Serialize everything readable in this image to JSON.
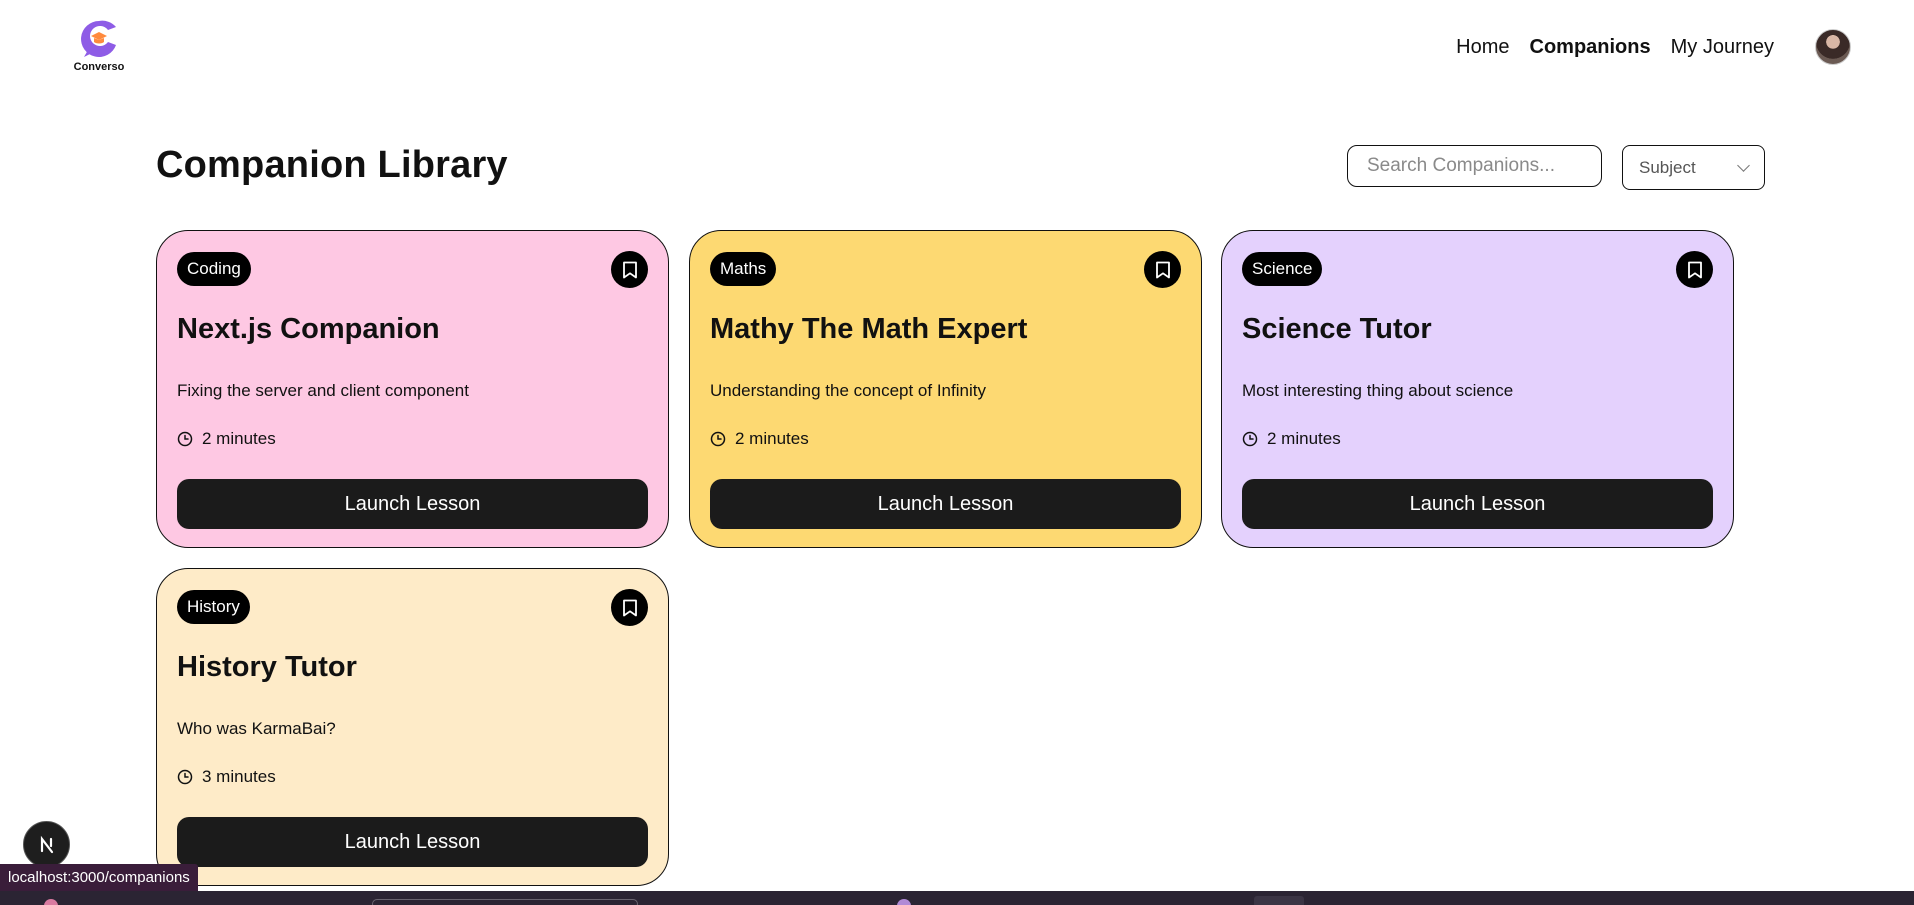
{
  "brand": {
    "name": "Converso"
  },
  "nav": {
    "links": [
      {
        "label": "Home",
        "active": false
      },
      {
        "label": "Companions",
        "active": true
      },
      {
        "label": "My Journey",
        "active": false
      }
    ]
  },
  "page": {
    "title": "Companion Library"
  },
  "search": {
    "placeholder": "Search Companions...",
    "value": ""
  },
  "filter": {
    "label": "Subject"
  },
  "companions": [
    {
      "subject": "Coding",
      "title": "Next.js Companion",
      "topic": "Fixing the server and client component",
      "duration": "2 minutes",
      "action": "Launch Lesson",
      "color": "#fec8e3"
    },
    {
      "subject": "Maths",
      "title": "Mathy The Math Expert",
      "topic": "Understanding the concept of Infinity",
      "duration": "2 minutes",
      "action": "Launch Lesson",
      "color": "#fdd972"
    },
    {
      "subject": "Science",
      "title": "Science Tutor",
      "topic": "Most interesting thing about science",
      "duration": "2 minutes",
      "action": "Launch Lesson",
      "color": "#e4d1fd"
    },
    {
      "subject": "History",
      "title": "History Tutor",
      "topic": "Who was KarmaBai?",
      "duration": "3 minutes",
      "action": "Launch Lesson",
      "color": "#feebc8"
    }
  ],
  "status_bar": {
    "url": "localhost:3000/companions"
  },
  "dev_badge": {
    "label": "N"
  }
}
